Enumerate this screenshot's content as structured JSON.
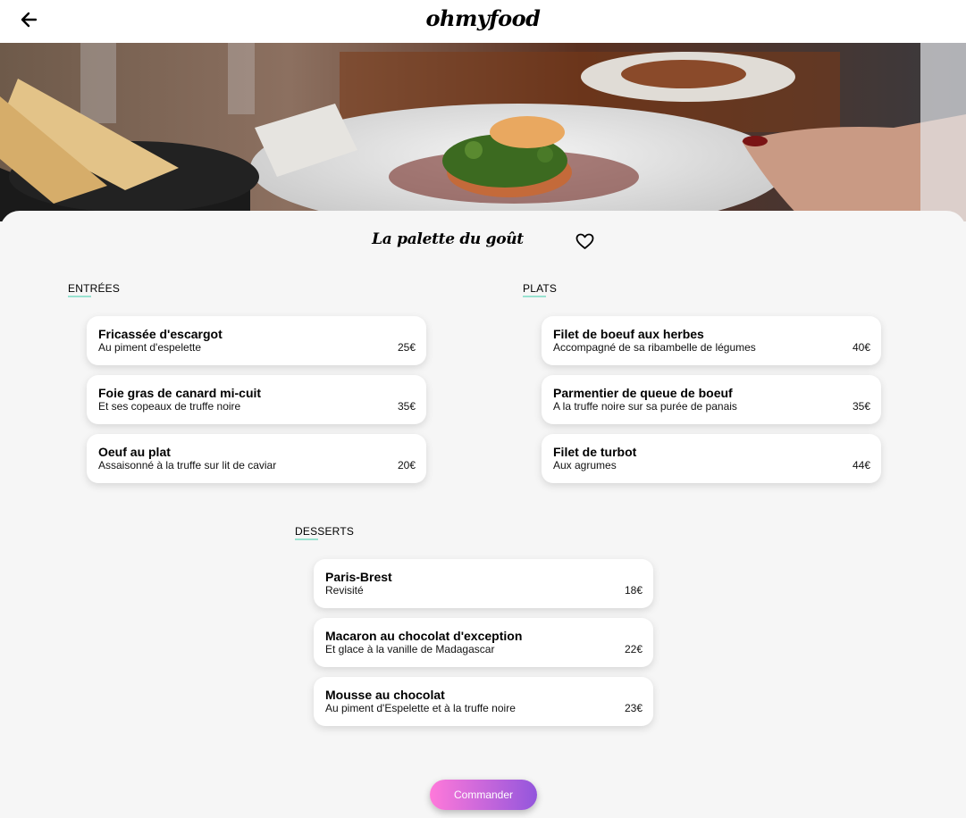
{
  "header": {
    "logo": "ohmyfood",
    "back_icon": "arrow-left-icon"
  },
  "restaurant": {
    "name": "La palette du goût",
    "favorite_icon": "heart-outline-icon"
  },
  "sections": {
    "entrees": {
      "title": "Entrées",
      "dishes": [
        {
          "name": "Fricassée d'escargot",
          "description": "Au piment d'espelette",
          "price": "25€"
        },
        {
          "name": "Foie gras de canard mi-cuit",
          "description": "Et ses copeaux de truffe noire",
          "price": "35€"
        },
        {
          "name": "Oeuf au plat",
          "description": "Assaisonné à la truffe sur lit de caviar",
          "price": "20€"
        }
      ]
    },
    "plats": {
      "title": "Plats",
      "dishes": [
        {
          "name": "Filet de boeuf aux herbes",
          "description": "Accompagné de sa ribambelle de légumes",
          "price": "40€"
        },
        {
          "name": "Parmentier de queue de boeuf",
          "description": "A la truffe noire sur sa purée de panais",
          "price": "35€"
        },
        {
          "name": "Filet de turbot",
          "description": "Aux agrumes",
          "price": "44€"
        }
      ]
    },
    "desserts": {
      "title": "Desserts",
      "dishes": [
        {
          "name": "Paris-Brest",
          "description": "Revisité",
          "price": "18€"
        },
        {
          "name": "Macaron au chocolat d'exception",
          "description": "Et glace à la vanille de Madagascar",
          "price": "22€"
        },
        {
          "name": "Mousse au chocolat",
          "description": "Au piment d'Espelette et à la truffe noire",
          "price": "23€"
        }
      ]
    }
  },
  "order_button": {
    "label": "Commander"
  },
  "colors": {
    "accent_gradient_start": "#ff79da",
    "accent_gradient_end": "#9356dc",
    "section_underline": "#99e2d0",
    "background": "#f6f6f6"
  }
}
